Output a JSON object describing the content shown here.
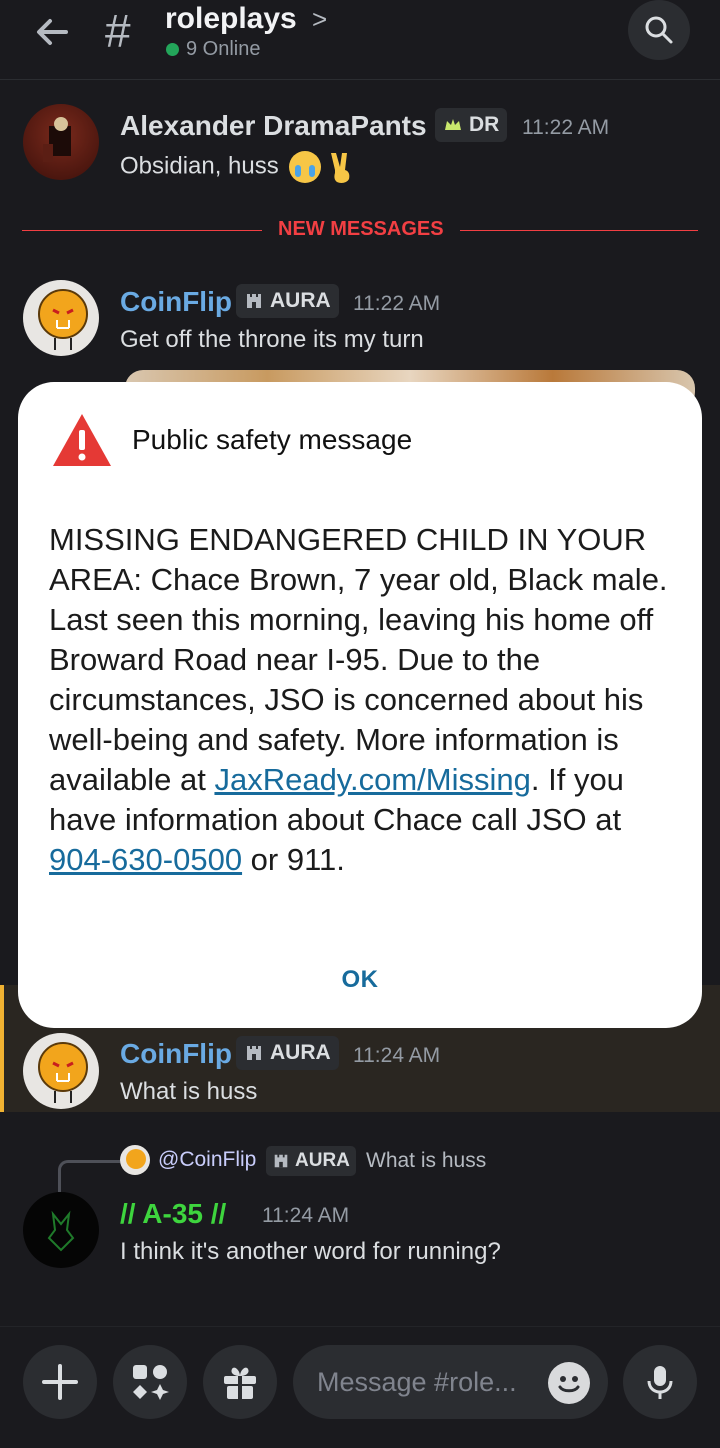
{
  "header": {
    "channel_hash": "#",
    "channel_name": "roleplays",
    "chevron": ">",
    "online_text": "9 Online"
  },
  "messages": [
    {
      "author": "Alexander DramaPants",
      "author_color": "#dbdee1",
      "badge": "DR",
      "time": "11:22 AM",
      "text": "Obsidian, huss"
    },
    {
      "author": "CoinFlip",
      "author_color": "#6aaae3",
      "badge": "AURA",
      "time": "11:22 AM",
      "text": "Get off the throne its my turn"
    },
    {
      "author": "CoinFlip",
      "author_color": "#6aaae3",
      "badge": "AURA",
      "time": "11:24 AM",
      "text": "What is huss"
    },
    {
      "author": "// A-35 //",
      "author_color": "#3ed53e",
      "time": "11:24 AM",
      "text": "I think it's another word for running?"
    }
  ],
  "divider": {
    "label": "NEW MESSAGES"
  },
  "reply": {
    "mention": "@CoinFlip",
    "badge": "AURA",
    "text": "What is huss"
  },
  "dialog": {
    "title": "Public safety message",
    "body_part1": "MISSING ENDANGERED CHILD IN YOUR AREA: Chace Brown, 7 year old, Black male. Last seen this morning, leaving his home off Broward Road near I-95.  Due to the circumstances, JSO is concerned about his well-being and safety. More information is available at ",
    "link": "JaxReady.com/Missing",
    "body_part2": ". If you have information about Chace call JSO at ",
    "phone": "904-630-0500",
    "body_part3": " or 911.",
    "ok_label": "OK"
  },
  "composer": {
    "placeholder": "Message #role..."
  },
  "colors": {
    "accent_red": "#f23f43",
    "link_blue": "#176b9c",
    "online_green": "#23a55a",
    "highlight_gold": "#f0b232"
  },
  "icons": [
    "back-arrow-icon",
    "search-icon",
    "warning-icon",
    "plus-icon",
    "apps-icon",
    "gift-icon",
    "emoji-icon",
    "microphone-icon"
  ]
}
